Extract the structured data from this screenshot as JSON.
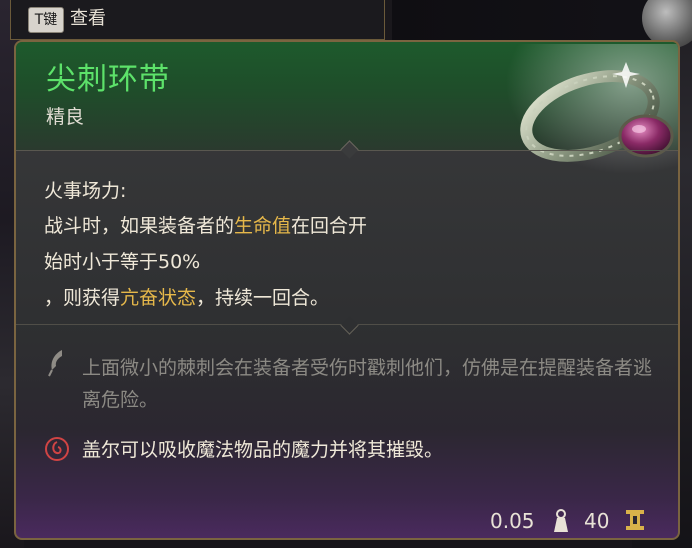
{
  "top_bar": {
    "key_label": "T键",
    "action_label": "查看"
  },
  "item": {
    "name": "尖刺环带",
    "rarity": "精良",
    "name_color": "#5de26a",
    "rarity_color": "#e0dcd2",
    "ring_icon": "ring-with-purple-gem-icon"
  },
  "ability": {
    "title": "火事场力:",
    "line1": {
      "before": "战斗时，如果装备者的",
      "keyword": "生命值",
      "after": "在回合开"
    },
    "line2": "始时小于等于50%",
    "line3": {
      "before": "，则获得",
      "keyword": "亢奋状态",
      "after": "，持续一回合。"
    },
    "keyword_color": "#e6b84a"
  },
  "flavor": {
    "icon": "quill-icon",
    "text": "上面微小的棘刺会在装备者受伤时戳刺他们，仿佛是在提醒装备者逃离危险。"
  },
  "gale_note": {
    "icon": "spiral-magic-icon",
    "text": "盖尔可以吸收魔法物品的魔力并将其摧毁。"
  },
  "footer": {
    "weight": "0.05",
    "weight_icon": "weight-icon",
    "price": "40",
    "price_icon": "gold-icon"
  }
}
